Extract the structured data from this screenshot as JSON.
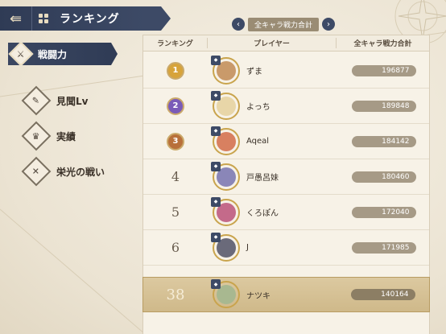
{
  "header": {
    "title": "ランキング",
    "back_icon": "back-arrow-icon",
    "menu_icon": "menu-grid-icon"
  },
  "sidebar": {
    "items": [
      {
        "label": "戦闘力",
        "icon": "sword-icon",
        "active": true
      },
      {
        "label": "見聞Lv",
        "icon": "scroll-icon",
        "active": false
      },
      {
        "label": "実績",
        "icon": "trophy-icon",
        "active": false
      },
      {
        "label": "栄光の戦い",
        "icon": "crossed-swords-icon",
        "active": false
      }
    ]
  },
  "banner": {
    "label": "全キャラ戦力合計",
    "prev_icon": "chevron-left-icon",
    "next_icon": "chevron-right-icon"
  },
  "table": {
    "columns": [
      "ランキング",
      "プレイヤー",
      "全キャラ戦力合計"
    ],
    "rows": [
      {
        "rank": "1",
        "name": "ずま",
        "power": "196877",
        "medal": "gold"
      },
      {
        "rank": "2",
        "name": "よっち",
        "power": "189848",
        "medal": "purple"
      },
      {
        "rank": "3",
        "name": "Aqeal",
        "power": "184142",
        "medal": "bronze"
      },
      {
        "rank": "4",
        "name": "戸愚呂妹",
        "power": "180460",
        "medal": null
      },
      {
        "rank": "5",
        "name": "くろぽん",
        "power": "172040",
        "medal": null
      },
      {
        "rank": "6",
        "name": "J",
        "power": "171985",
        "medal": null
      }
    ]
  },
  "self": {
    "rank": "38",
    "name": "ナツキ",
    "power": "140164"
  },
  "colors": {
    "navy": "#2f3b55",
    "gold_medal": "#d7a33a",
    "purple_medal": "#7a5bb8",
    "bronze_medal": "#b8703a",
    "highlight": "#d6c294"
  }
}
